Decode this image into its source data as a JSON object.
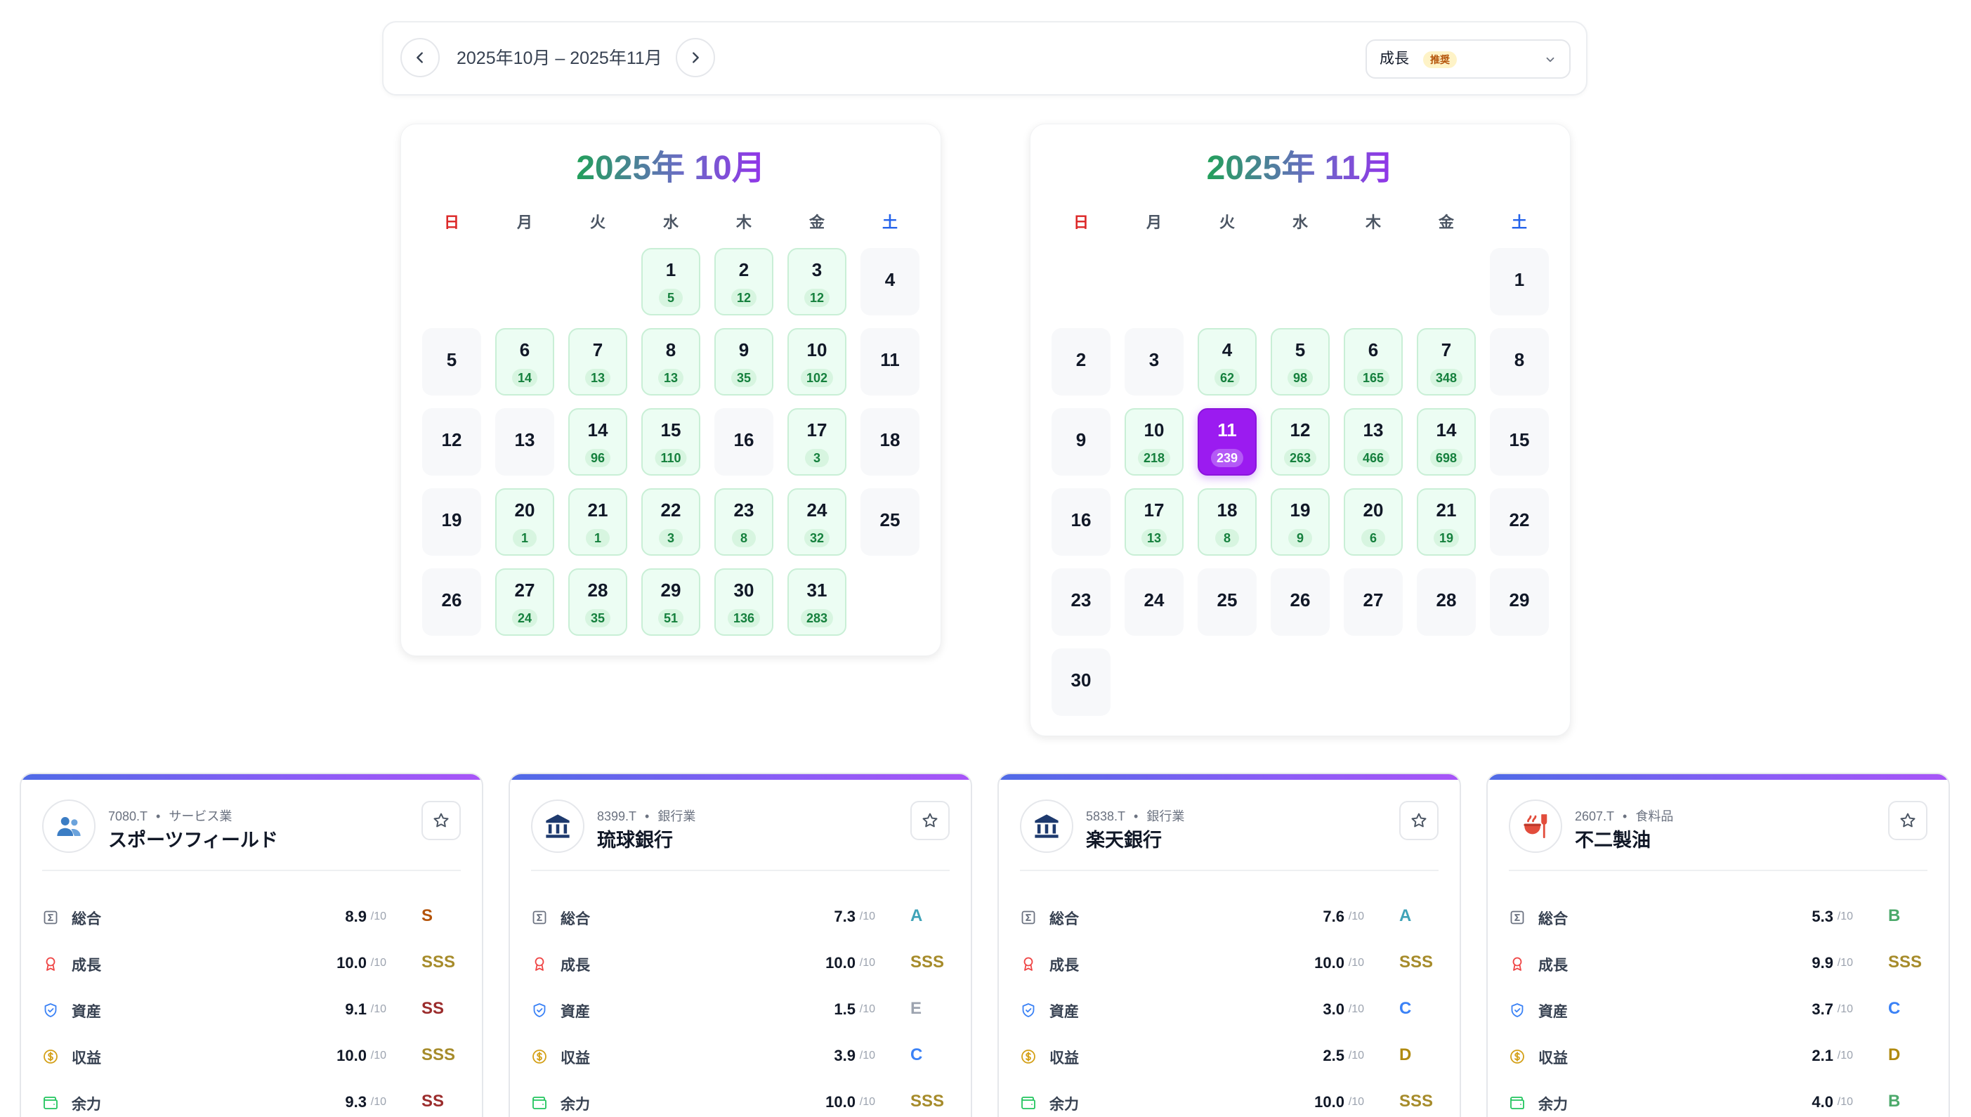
{
  "nav": {
    "range_label": "2025年10月 – 2025年11月",
    "mode": "成長",
    "mode_badge": "推奨",
    "prev_icon": "chevron-left-icon",
    "next_icon": "chevron-right-icon"
  },
  "weekdays": [
    "日",
    "月",
    "火",
    "水",
    "木",
    "金",
    "土"
  ],
  "calendars": [
    {
      "title": "2025年 10月",
      "first_weekday": 3,
      "days_in_month": 31,
      "counts": {
        "1": "5",
        "2": "12",
        "3": "12",
        "6": "14",
        "7": "13",
        "8": "13",
        "9": "35",
        "10": "102",
        "14": "96",
        "15": "110",
        "17": "3",
        "20": "1",
        "21": "1",
        "22": "3",
        "23": "8",
        "24": "32",
        "27": "24",
        "28": "35",
        "29": "51",
        "30": "136",
        "31": "283"
      },
      "selected": null
    },
    {
      "title": "2025年 11月",
      "first_weekday": 6,
      "days_in_month": 30,
      "counts": {
        "4": "62",
        "5": "98",
        "6": "165",
        "7": "348",
        "10": "218",
        "11": "239",
        "12": "263",
        "13": "466",
        "14": "698",
        "17": "13",
        "18": "8",
        "19": "9",
        "20": "6",
        "21": "19"
      },
      "selected": 11
    }
  ],
  "colors": {
    "accent": "#9333ea",
    "green": "#15803d",
    "sunday": "#dc2626",
    "saturday": "#2563eb"
  },
  "stocks": [
    {
      "code": "7080.T",
      "sector": "サービス業",
      "name": "スポーツフィールド",
      "icon": "user-group-icon",
      "metrics": [
        {
          "label": "総合",
          "value": "8.9",
          "denom": "/10",
          "grade": "S",
          "icon": "sigma-icon"
        },
        {
          "label": "成長",
          "value": "10.0",
          "denom": "/10",
          "grade": "SSS",
          "icon": "award-icon"
        },
        {
          "label": "資産",
          "value": "9.1",
          "denom": "/10",
          "grade": "SS",
          "icon": "shield-icon"
        },
        {
          "label": "収益",
          "value": "10.0",
          "denom": "/10",
          "grade": "SSS",
          "icon": "coin-icon"
        },
        {
          "label": "余力",
          "value": "9.3",
          "denom": "/10",
          "grade": "SS",
          "icon": "wallet-icon"
        }
      ]
    },
    {
      "code": "8399.T",
      "sector": "銀行業",
      "name": "琉球銀行",
      "icon": "bank-icon",
      "metrics": [
        {
          "label": "総合",
          "value": "7.3",
          "denom": "/10",
          "grade": "A",
          "icon": "sigma-icon"
        },
        {
          "label": "成長",
          "value": "10.0",
          "denom": "/10",
          "grade": "SSS",
          "icon": "award-icon"
        },
        {
          "label": "資産",
          "value": "1.5",
          "denom": "/10",
          "grade": "E",
          "icon": "shield-icon"
        },
        {
          "label": "収益",
          "value": "3.9",
          "denom": "/10",
          "grade": "C",
          "icon": "coin-icon"
        },
        {
          "label": "余力",
          "value": "10.0",
          "denom": "/10",
          "grade": "SSS",
          "icon": "wallet-icon"
        }
      ]
    },
    {
      "code": "5838.T",
      "sector": "銀行業",
      "name": "楽天銀行",
      "icon": "bank-icon",
      "metrics": [
        {
          "label": "総合",
          "value": "7.6",
          "denom": "/10",
          "grade": "A",
          "icon": "sigma-icon"
        },
        {
          "label": "成長",
          "value": "10.0",
          "denom": "/10",
          "grade": "SSS",
          "icon": "award-icon"
        },
        {
          "label": "資産",
          "value": "3.0",
          "denom": "/10",
          "grade": "C",
          "icon": "shield-icon"
        },
        {
          "label": "収益",
          "value": "2.5",
          "denom": "/10",
          "grade": "D",
          "icon": "coin-icon"
        },
        {
          "label": "余力",
          "value": "10.0",
          "denom": "/10",
          "grade": "SSS",
          "icon": "wallet-icon"
        }
      ]
    },
    {
      "code": "2607.T",
      "sector": "食料品",
      "name": "不二製油",
      "icon": "food-icon",
      "metrics": [
        {
          "label": "総合",
          "value": "5.3",
          "denom": "/10",
          "grade": "B",
          "icon": "sigma-icon"
        },
        {
          "label": "成長",
          "value": "9.9",
          "denom": "/10",
          "grade": "SSS",
          "icon": "award-icon"
        },
        {
          "label": "資産",
          "value": "3.7",
          "denom": "/10",
          "grade": "C",
          "icon": "shield-icon"
        },
        {
          "label": "収益",
          "value": "2.1",
          "denom": "/10",
          "grade": "D",
          "icon": "coin-icon"
        },
        {
          "label": "余力",
          "value": "4.0",
          "denom": "/10",
          "grade": "B",
          "icon": "wallet-icon"
        }
      ]
    }
  ]
}
